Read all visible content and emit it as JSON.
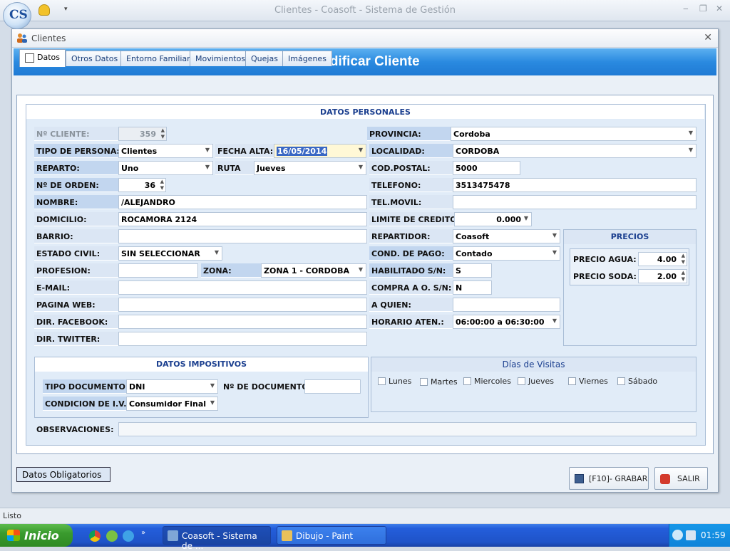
{
  "app": {
    "title": "Clientes - Coasoft - Sistema de Gestión",
    "logo_text": "CS",
    "status": "Listo",
    "window_controls": [
      "‒",
      "❐",
      "✕"
    ]
  },
  "dialog": {
    "title": "Clientes",
    "banner": "Modificar Cliente",
    "tabs": [
      "Datos",
      "Otros Datos",
      "Entorno Familiar",
      "Movimientos",
      "Quejas",
      "Imágenes"
    ],
    "section_title": "DATOS PERSONALES",
    "left": {
      "nro_cliente_label": "Nº CLIENTE:",
      "nro_cliente": "359",
      "tipo_persona_label": "TIPO DE PERSONA:",
      "tipo_persona": "Clientes",
      "fecha_alta_label": "FECHA ALTA:",
      "fecha_alta": "16/05/2014",
      "reparto_label": "REPARTO:",
      "reparto": "Uno",
      "ruta_label": "RUTA",
      "ruta": "Jueves",
      "orden_label": "Nº DE ORDEN:",
      "orden": "36",
      "nombre_label": "NOMBRE:",
      "nombre": "/ALEJANDRO",
      "domicilio_label": "DOMICILIO:",
      "domicilio": "ROCAMORA 2124",
      "barrio_label": "BARRIO:",
      "barrio": "",
      "estado_civil_label": "ESTADO CIVIL:",
      "estado_civil": "SIN SELECCIONAR",
      "profesion_label": "PROFESION:",
      "profesion": "",
      "zona_label": "ZONA:",
      "zona": "ZONA 1 - CORDOBA",
      "email_label": "E-MAIL:",
      "email": "",
      "web_label": "PAGINA WEB:",
      "web": "",
      "facebook_label": "DIR. FACEBOOK:",
      "facebook": "",
      "twitter_label": "DIR. TWITTER:",
      "twitter": ""
    },
    "right": {
      "provincia_label": "PROVINCIA:",
      "provincia": "Cordoba",
      "localidad_label": "LOCALIDAD:",
      "localidad": "CORDOBA",
      "cp_label": "COD.POSTAL:",
      "cp": "5000",
      "telefono_label": "TELEFONO:",
      "telefono": "3513475478",
      "movil_label": "TEL.MOVIL:",
      "movil": "",
      "credito_label": "LIMITE DE CREDITO:",
      "credito": "0.000",
      "repartidor_label": "REPARTIDOR:",
      "repartidor": "Coasoft",
      "pago_label": "COND. DE PAGO:",
      "pago": "Contado",
      "habilitado_label": "HABILITADO S/N:",
      "habilitado": "S",
      "compra_label": "COMPRA A O. S/N:",
      "compra": "N",
      "quien_label": "A QUIEN:",
      "quien": "",
      "horario_label": "HORARIO ATEN.:",
      "horario": "06:00:00 a 06:30:00"
    },
    "precios": {
      "title": "PRECIOS",
      "agua_label": "PRECIO AGUA:",
      "agua": "4.00",
      "soda_label": "PRECIO SODA:",
      "soda": "2.00"
    },
    "impositivos": {
      "title": "DATOS IMPOSITIVOS",
      "tipo_doc_label": "TIPO DOCUMENTO:",
      "tipo_doc": "DNI",
      "nro_doc_label": "Nº DE DOCUMENTO:",
      "nro_doc": "",
      "iva_label": "CONDICION DE I.V.A.:",
      "iva": "Consumidor Final"
    },
    "visitas": {
      "title": "Días de Visitas",
      "days": [
        "Lunes",
        "Martes",
        "Miercoles",
        "Jueves",
        "Viernes",
        "Sábado"
      ]
    },
    "observaciones_label": "OBSERVACIONES:",
    "observaciones": "",
    "obligatorios": "Datos Obligatorios",
    "grabar": "[F10]- GRABAR",
    "salir": "SALIR"
  },
  "taskbar": {
    "start": "Inicio",
    "tasks": [
      "Coasoft - Sistema de ...",
      "Dibujo - Paint"
    ],
    "clock": "01:59"
  },
  "colors": {
    "accent": "#2a8ae0",
    "label_bg": "#dbe6f4",
    "panel_bg": "#e1ecf8"
  }
}
